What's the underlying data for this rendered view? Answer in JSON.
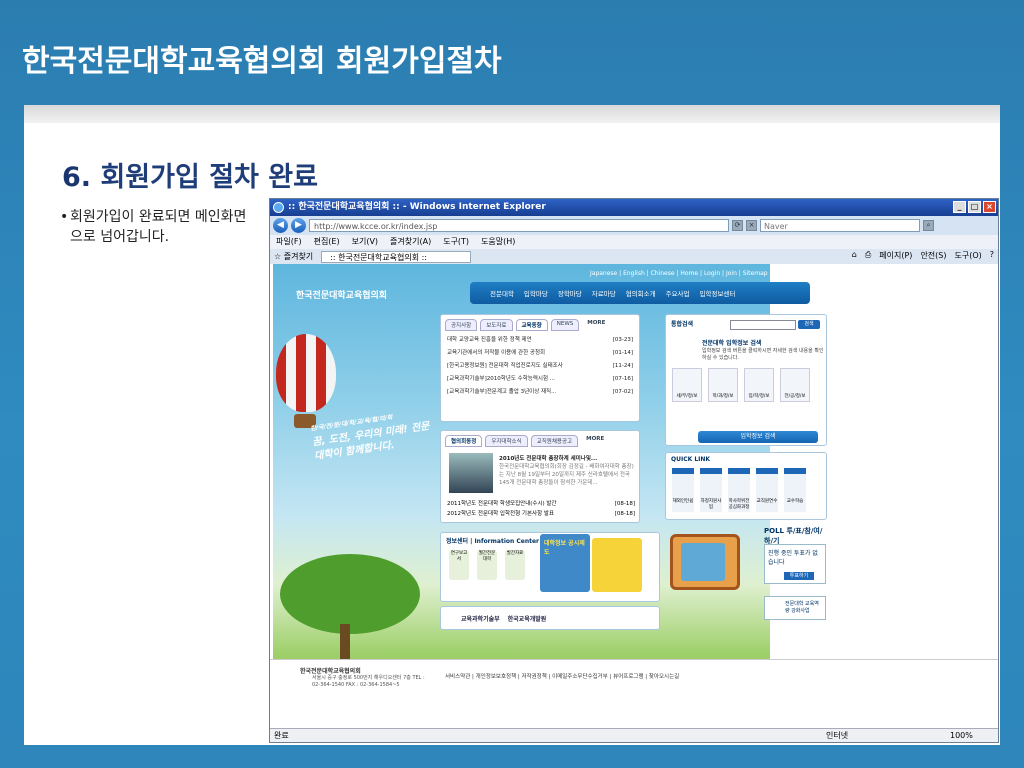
{
  "slide": {
    "title": "한국전문대학교육협의회 회원가입절차",
    "heading_num": "6.",
    "heading_text": "회원가입 절차 완료",
    "bullet": "회원가입이 완료되면 메인화면으로 넘어갑니다."
  },
  "browser": {
    "window_title": ":: 한국전문대학교육협의회 :: - Windows Internet Explorer",
    "address": "http://www.kcce.or.kr/index.jsp",
    "search_placeholder": "Naver",
    "menu": [
      "파일(F)",
      "편집(E)",
      "보기(V)",
      "즐겨찾기(A)",
      "도구(T)",
      "도움말(H)"
    ],
    "favorites_label": "즐겨찾기",
    "tab_label": ":: 한국전문대학교육협의회 ::",
    "commands": [
      "페이지(P)",
      "안전(S)",
      "도구(O)"
    ],
    "status_left": "완료",
    "status_zone": "인터넷",
    "zoom": "100%"
  },
  "site": {
    "util_links": "Japanese | English | Chinese | Home | Login | Join | Sitemap | Contact us",
    "logo": "한국전문대학교육협의회",
    "nav": [
      "전문대학",
      "입학마당",
      "장학마당",
      "자료마당",
      "협의회소개",
      "주요사업",
      "입학정보센터"
    ],
    "slogan_top": "한/국/전/문/대/학/교/육/협/의/회",
    "slogan": "꿈, 도전, 우리의 미래! 전문대학이 함께합니다.",
    "news_tabs": [
      "공지사항",
      "보도자료",
      "교육동향",
      "NEWS"
    ],
    "news_more": "MORE",
    "news": [
      {
        "title": "대학 교양교육 진흥을 위한 정책 제언",
        "date": "[03-23]"
      },
      {
        "title": "교육기관에서의 저작물 이용에 관한 공청회",
        "date": "[01-14]"
      },
      {
        "title": "[한국고용정보원] 전문대학 직업진로지도 실태조사",
        "date": "[11-24]"
      },
      {
        "title": "[교육과학기술부]2010학년도 수학능력시험 ...",
        "date": "[07-16]"
      },
      {
        "title": "[교육과학기술부]전문계고 졸업 3년이상 재직...",
        "date": "[07-02]"
      }
    ],
    "assoc_tabs": [
      "협의회동정",
      "우지대학소식",
      "교직원채용공고"
    ],
    "assoc_more": "MORE",
    "assoc_feature": "2010년도 전문대학 총장하계 세미나및...",
    "assoc_feature_desc": "한국전문대학교육협의회(회장 김정길 - 배화여자대학 총장)는 지난 8월 19일부터 20일까지 제주 신라호텔에서 전국 145개 전문대학 총장들이 참석한 가운데...",
    "assoc_news": [
      {
        "title": "2011학년도 전문대학 학생모집안내(수시) 발간",
        "date": "[08-18]"
      },
      {
        "title": "2012학년도 전문대학 입학전형 기본사항 발표",
        "date": "[08-18]"
      }
    ],
    "info_header": "정보센터 | Information Center",
    "info_icons": [
      "연구보고서",
      "월간전문대학",
      "발간자료"
    ],
    "banner_text": "대학정보 공시제도",
    "partners": [
      "교육과학기술부",
      "한국교육개발원"
    ],
    "search_title": "통합검색",
    "search_go": "검색",
    "admission_title": "전문대학 입학정보 검색",
    "admission_desc": "입학정보 검색 버튼을 클릭하시면 자세한 검색 내용을 확인하실 수 있습니다.",
    "admission_cats": [
      "세/부/정/보",
      "학/과/정/보",
      "입/학/정/보",
      "전/공/정/보"
    ],
    "admission_button": "입학정보 검색",
    "quick_title": "QUICK LINK",
    "quick": [
      "해외인턴쉽",
      "자정지원사업",
      "학사학위전공심화과정",
      "교직원연수",
      "교수학습"
    ],
    "poll_title": "POLL 투/표/참/여/하/기",
    "poll_text": "진행 중인 투표가 없습니다",
    "poll_button": "투표하기",
    "poll_logo": "전문대학 교육역량 강화사업",
    "footer_org": "한국전문대학교육협의회",
    "footer_addr": "서울시 중구 충정로 500번지 해우디오센터 7층 TEL : 02-364-1540 FAX : 02-364-1584~5",
    "footer_links": "서비스약관 | 개인정보보호정책 | 저작권정책 | 이메일주소무단수집거부 | 뷰어프로그램 | 찾아오시는길"
  },
  "colors": {
    "slide_bg": "#2d84b5",
    "heading": "#1f3e79",
    "nav": "#1a6fb8"
  }
}
